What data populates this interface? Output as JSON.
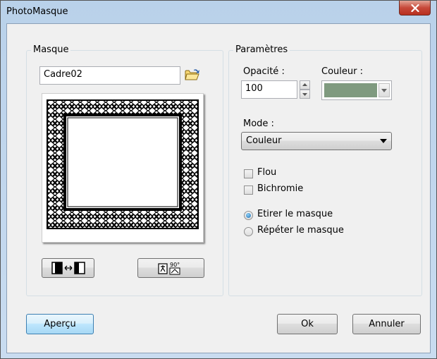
{
  "window": {
    "title": "PhotoMasque"
  },
  "masque": {
    "group_label": "Masque",
    "name_value": "Cadre02",
    "preview_icon": "celtic-frame-preview"
  },
  "parametres": {
    "group_label": "Paramètres",
    "opacite_label": "Opacité :",
    "opacite_value": "100",
    "couleur_label": "Couleur :",
    "couleur_value": "#7f9a7f",
    "mode_label": "Mode :",
    "mode_value": "Couleur",
    "flou_label": "Flou",
    "flou_checked": false,
    "bichromie_label": "Bichromie",
    "bichromie_checked": false,
    "etirer_label": "Etirer le masque",
    "etirer_checked": true,
    "repeter_label": "Répéter le masque",
    "repeter_checked": false
  },
  "buttons": {
    "apercu": "Aperçu",
    "ok": "Ok",
    "annuler": "Annuler"
  }
}
